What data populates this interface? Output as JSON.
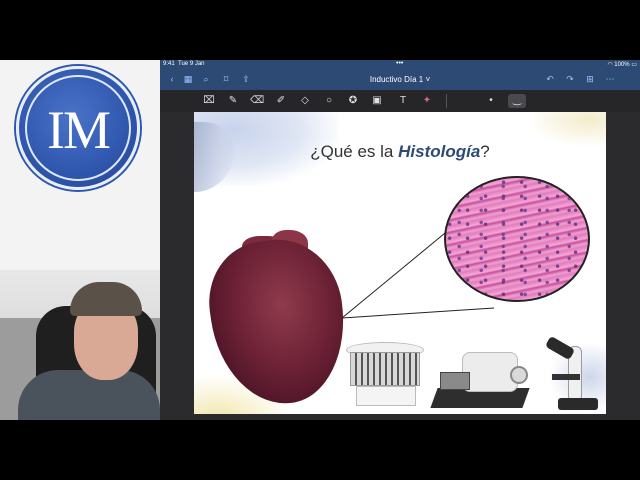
{
  "logo": {
    "text": "IM"
  },
  "status_bar": {
    "time": "9:41",
    "date": "Tue 9 Jan",
    "dots": "•••",
    "battery": "100%"
  },
  "nav": {
    "title": "Inductivo Día 1",
    "icons": [
      "chevron-left-icon",
      "grid-icon",
      "search-icon",
      "bookmark-icon",
      "share-icon",
      "undo-icon",
      "redo-icon",
      "add-page-icon",
      "more-icon"
    ]
  },
  "toolbar": {
    "tools": [
      "lasso-icon",
      "pen-icon",
      "eraser-icon",
      "highlighter-icon",
      "shapes-icon",
      "lasso-select-icon",
      "sticker-icon",
      "image-icon",
      "text-icon",
      "laser-icon",
      "dot-size-icon",
      "stroke-icon"
    ]
  },
  "slide": {
    "title_prefix": "¿Qué es la ",
    "title_emph": "Histología",
    "title_suffix": "?"
  },
  "colors": {
    "nav_bg": "#2c4a73",
    "accent": "#2d4a76",
    "histology_pink": "#e57ec0"
  }
}
